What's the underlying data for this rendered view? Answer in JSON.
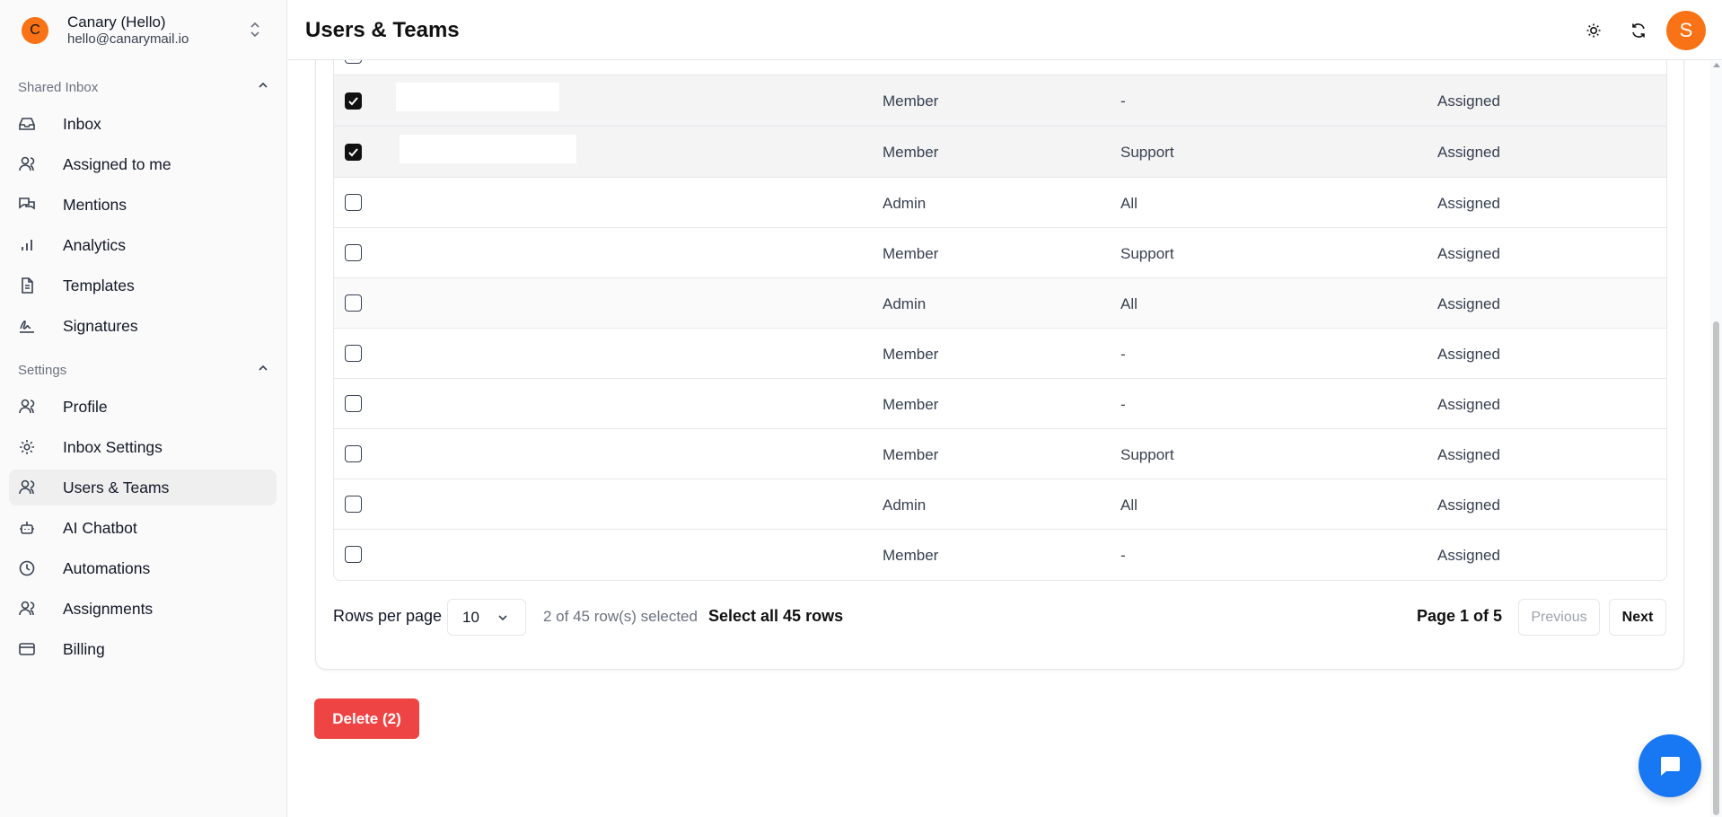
{
  "account": {
    "avatar_letter": "C",
    "name": "Canary (Hello)",
    "email": "hello@canarymail.io",
    "avatar_color": "#f97316"
  },
  "sidebar": {
    "shared_inbox_label": "Shared Inbox",
    "shared_inbox_items": [
      {
        "label": "Inbox",
        "icon": "inbox-icon"
      },
      {
        "label": "Assigned to me",
        "icon": "user-icon"
      },
      {
        "label": "Mentions",
        "icon": "messages-icon"
      },
      {
        "label": "Analytics",
        "icon": "bar-chart-icon"
      },
      {
        "label": "Templates",
        "icon": "file-text-icon"
      },
      {
        "label": "Signatures",
        "icon": "signature-icon"
      }
    ],
    "settings_label": "Settings",
    "settings_items": [
      {
        "label": "Profile",
        "icon": "users-icon"
      },
      {
        "label": "Inbox Settings",
        "icon": "gear-icon"
      },
      {
        "label": "Users & Teams",
        "icon": "users-icon",
        "active": true
      },
      {
        "label": "AI Chatbot",
        "icon": "bot-icon"
      },
      {
        "label": "Automations",
        "icon": "clock-icon"
      },
      {
        "label": "Assignments",
        "icon": "users-icon"
      },
      {
        "label": "Billing",
        "icon": "credit-card-icon"
      }
    ]
  },
  "header": {
    "title": "Users & Teams",
    "user_avatar_letter": "S"
  },
  "table": {
    "rows": [
      {
        "checked": true,
        "role": "Member",
        "team": "-",
        "status": "Assigned"
      },
      {
        "checked": true,
        "role": "Member",
        "team": "Support",
        "status": "Assigned"
      },
      {
        "checked": false,
        "role": "Admin",
        "team": "All",
        "status": "Assigned"
      },
      {
        "checked": false,
        "role": "Member",
        "team": "Support",
        "status": "Assigned"
      },
      {
        "checked": false,
        "role": "Admin",
        "team": "All",
        "status": "Assigned"
      },
      {
        "checked": false,
        "role": "Member",
        "team": "-",
        "status": "Assigned"
      },
      {
        "checked": false,
        "role": "Member",
        "team": "-",
        "status": "Assigned"
      },
      {
        "checked": false,
        "role": "Member",
        "team": "Support",
        "status": "Assigned"
      },
      {
        "checked": false,
        "role": "Admin",
        "team": "All",
        "status": "Assigned"
      },
      {
        "checked": false,
        "role": "Member",
        "team": "-",
        "status": "Assigned"
      }
    ]
  },
  "pagination": {
    "rows_per_page_label": "Rows per page",
    "rows_per_page_value": "10",
    "selection_text": "2 of 45 row(s) selected",
    "select_all_text": "Select all 45 rows",
    "page_text": "Page 1 of 5",
    "previous_label": "Previous",
    "next_label": "Next"
  },
  "actions": {
    "delete_label": "Delete (2)"
  },
  "colors": {
    "accent": "#f97316",
    "danger": "#ef4444",
    "chat": "#1877f2"
  }
}
